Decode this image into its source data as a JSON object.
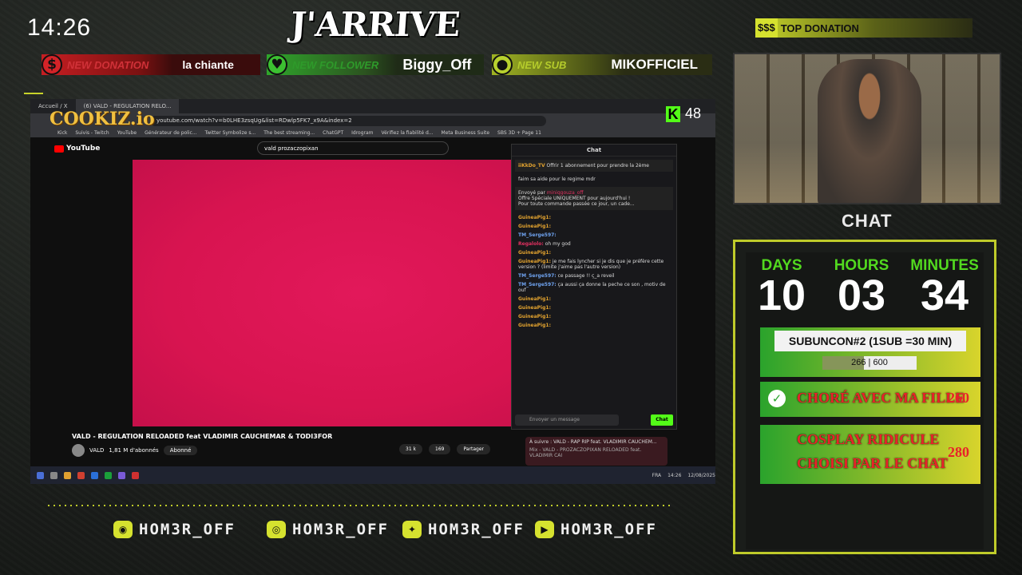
{
  "clock": "14:26",
  "logo_title": "J'ARRIVE",
  "alerts": {
    "donation": {
      "label": "NEW DONATION",
      "value": "la chiante",
      "icon": "$"
    },
    "follower": {
      "label": "NEW FOLLOWER",
      "value": "Biggy_Off",
      "icon": "♥"
    },
    "sub": {
      "label": "NEW SUB",
      "value": "MIKOFFICIEL",
      "icon": "👤"
    }
  },
  "top_donation": {
    "icon": "$$$",
    "label": "TOP DONATION"
  },
  "screen": {
    "tabs": [
      "Accueil / X",
      "(6) VALD - REGULATION RELO..."
    ],
    "url": "youtube.com/watch?v=b0LHE3zsqUg&list=RDwlp5FK7_x9A&index=2",
    "bookmarks": [
      "Kick",
      "Suivis - Twitch",
      "YouTube",
      "Générateur de polic...",
      "Twitter Symbolize s...",
      "The best streaming...",
      "ChatGPT",
      "Idrogram",
      "Vérifiez la fiabilité d...",
      "Meta Business Suite",
      "SBS 3D + Page 11"
    ],
    "cookiz": "COOKIZ.io",
    "kick_count": "48",
    "yt_brand": "YouTube",
    "search": "vald prozaczopixan",
    "video_title": "VALD - REGULATION RELOADED feat VLADIMIR CAUCHEMAR & TODI3FOR",
    "channel": "VALD",
    "subs": "1,81 M d'abonnés",
    "subscribed": "Abonné",
    "likes": "31 k",
    "comments": "169",
    "share": "Partager",
    "up_next": "À suivre : VALD - RAP RIP feat. VLADIMIR CAUCHEM...",
    "up_next_sub": "Mix - VALD - PROZACZOPIXAN RELOADED feat. VLADIMIR CAI",
    "taskbar_time": "14:26",
    "taskbar_date": "12/08/2025",
    "taskbar_lang": "FRA",
    "chat": {
      "header": "Chat",
      "gift_user": "iiKkDo_TV",
      "gift_text": "Offrir 1 abonnement pour prendre la 2ème",
      "note": "faim sa aide pour le regime mdr",
      "pinned_by": "Envoyé par",
      "pinned_user": "miniqgouza_off",
      "pinned_1": "Offre Spéciale UNIQUEMENT pour aujourd'hui !",
      "pinned_2": "Pour toute commande passée ce jour, un cade...",
      "lines": [
        {
          "user": "GuineaPig1:",
          "msg": ""
        },
        {
          "user": "GuineaPig1:",
          "msg": ""
        },
        {
          "user": "TM_Serge597:",
          "msg": ""
        },
        {
          "user": "Regalolo:",
          "msg": "oh my god"
        },
        {
          "user": "GuineaPig1:",
          "msg": ""
        },
        {
          "user": "GuineaPig1:",
          "msg": "je me fais lyncher si je dis que je préfère cette version ? (limite j'aime pas l'autre version)"
        },
        {
          "user": "TM_Serge597:",
          "msg": "ce passage !! ç_a reveil"
        },
        {
          "user": "TM_Serge597:",
          "msg": "ça aussi ça donne la peche ce son , motiv de ouf"
        },
        {
          "user": "GuineaPig1:",
          "msg": ""
        },
        {
          "user": "GuineaPig1:",
          "msg": ""
        },
        {
          "user": "GuineaPig1:",
          "msg": ""
        },
        {
          "user": "GuineaPig1:",
          "msg": ""
        }
      ],
      "input_placeholder": "Envoyer un message",
      "send": "Chat"
    }
  },
  "chat_label": "CHAT",
  "timer": {
    "days_label": "DAYS",
    "days": "10",
    "hours_label": "HOURS",
    "hours": "03",
    "minutes_label": "MINUTES",
    "minutes": "34"
  },
  "subathon": {
    "title": "SUBUNCON#2 (1SUB =30 MIN)",
    "current": "266",
    "target": "600",
    "progress_fraction": 0.443
  },
  "goals": [
    {
      "text": "CHORÉ AVEC MA FILLE",
      "cost": "260",
      "done": true
    },
    {
      "text": "COSPLAY RIDICULE",
      "text2": "CHOISI PAR LE CHAT",
      "cost": "280",
      "done": false
    }
  ],
  "socials": [
    {
      "icon": "discord-icon",
      "handle": "HOM3R_OFF"
    },
    {
      "icon": "instagram-icon",
      "handle": "HOM3R_OFF"
    },
    {
      "icon": "twitter-icon",
      "handle": "HOM3R_OFF"
    },
    {
      "icon": "youtube-icon",
      "handle": "HOM3R_OFF"
    }
  ],
  "colors": {
    "accent": "#c8d32a",
    "kick": "#53fc18",
    "video": "#d81450",
    "goal_text": "#e8222a"
  }
}
